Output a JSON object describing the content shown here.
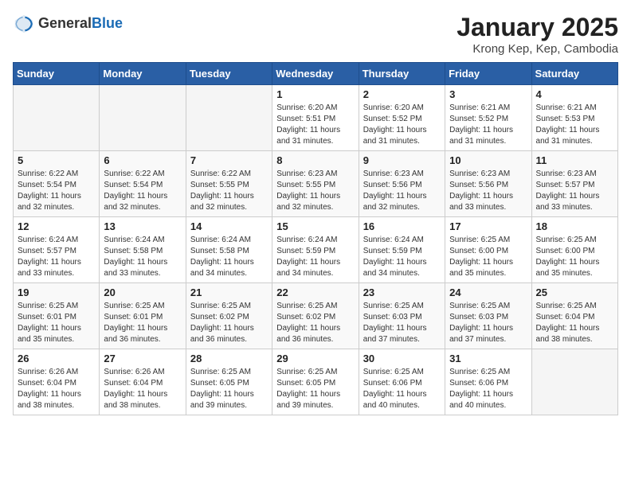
{
  "header": {
    "logo_general": "General",
    "logo_blue": "Blue",
    "month": "January 2025",
    "location": "Krong Kep, Kep, Cambodia"
  },
  "weekdays": [
    "Sunday",
    "Monday",
    "Tuesday",
    "Wednesday",
    "Thursday",
    "Friday",
    "Saturday"
  ],
  "weeks": [
    [
      {
        "day": "",
        "sunrise": "",
        "sunset": "",
        "daylight": ""
      },
      {
        "day": "",
        "sunrise": "",
        "sunset": "",
        "daylight": ""
      },
      {
        "day": "",
        "sunrise": "",
        "sunset": "",
        "daylight": ""
      },
      {
        "day": "1",
        "sunrise": "Sunrise: 6:20 AM",
        "sunset": "Sunset: 5:51 PM",
        "daylight": "Daylight: 11 hours and 31 minutes."
      },
      {
        "day": "2",
        "sunrise": "Sunrise: 6:20 AM",
        "sunset": "Sunset: 5:52 PM",
        "daylight": "Daylight: 11 hours and 31 minutes."
      },
      {
        "day": "3",
        "sunrise": "Sunrise: 6:21 AM",
        "sunset": "Sunset: 5:52 PM",
        "daylight": "Daylight: 11 hours and 31 minutes."
      },
      {
        "day": "4",
        "sunrise": "Sunrise: 6:21 AM",
        "sunset": "Sunset: 5:53 PM",
        "daylight": "Daylight: 11 hours and 31 minutes."
      }
    ],
    [
      {
        "day": "5",
        "sunrise": "Sunrise: 6:22 AM",
        "sunset": "Sunset: 5:54 PM",
        "daylight": "Daylight: 11 hours and 32 minutes."
      },
      {
        "day": "6",
        "sunrise": "Sunrise: 6:22 AM",
        "sunset": "Sunset: 5:54 PM",
        "daylight": "Daylight: 11 hours and 32 minutes."
      },
      {
        "day": "7",
        "sunrise": "Sunrise: 6:22 AM",
        "sunset": "Sunset: 5:55 PM",
        "daylight": "Daylight: 11 hours and 32 minutes."
      },
      {
        "day": "8",
        "sunrise": "Sunrise: 6:23 AM",
        "sunset": "Sunset: 5:55 PM",
        "daylight": "Daylight: 11 hours and 32 minutes."
      },
      {
        "day": "9",
        "sunrise": "Sunrise: 6:23 AM",
        "sunset": "Sunset: 5:56 PM",
        "daylight": "Daylight: 11 hours and 32 minutes."
      },
      {
        "day": "10",
        "sunrise": "Sunrise: 6:23 AM",
        "sunset": "Sunset: 5:56 PM",
        "daylight": "Daylight: 11 hours and 33 minutes."
      },
      {
        "day": "11",
        "sunrise": "Sunrise: 6:23 AM",
        "sunset": "Sunset: 5:57 PM",
        "daylight": "Daylight: 11 hours and 33 minutes."
      }
    ],
    [
      {
        "day": "12",
        "sunrise": "Sunrise: 6:24 AM",
        "sunset": "Sunset: 5:57 PM",
        "daylight": "Daylight: 11 hours and 33 minutes."
      },
      {
        "day": "13",
        "sunrise": "Sunrise: 6:24 AM",
        "sunset": "Sunset: 5:58 PM",
        "daylight": "Daylight: 11 hours and 33 minutes."
      },
      {
        "day": "14",
        "sunrise": "Sunrise: 6:24 AM",
        "sunset": "Sunset: 5:58 PM",
        "daylight": "Daylight: 11 hours and 34 minutes."
      },
      {
        "day": "15",
        "sunrise": "Sunrise: 6:24 AM",
        "sunset": "Sunset: 5:59 PM",
        "daylight": "Daylight: 11 hours and 34 minutes."
      },
      {
        "day": "16",
        "sunrise": "Sunrise: 6:24 AM",
        "sunset": "Sunset: 5:59 PM",
        "daylight": "Daylight: 11 hours and 34 minutes."
      },
      {
        "day": "17",
        "sunrise": "Sunrise: 6:25 AM",
        "sunset": "Sunset: 6:00 PM",
        "daylight": "Daylight: 11 hours and 35 minutes."
      },
      {
        "day": "18",
        "sunrise": "Sunrise: 6:25 AM",
        "sunset": "Sunset: 6:00 PM",
        "daylight": "Daylight: 11 hours and 35 minutes."
      }
    ],
    [
      {
        "day": "19",
        "sunrise": "Sunrise: 6:25 AM",
        "sunset": "Sunset: 6:01 PM",
        "daylight": "Daylight: 11 hours and 35 minutes."
      },
      {
        "day": "20",
        "sunrise": "Sunrise: 6:25 AM",
        "sunset": "Sunset: 6:01 PM",
        "daylight": "Daylight: 11 hours and 36 minutes."
      },
      {
        "day": "21",
        "sunrise": "Sunrise: 6:25 AM",
        "sunset": "Sunset: 6:02 PM",
        "daylight": "Daylight: 11 hours and 36 minutes."
      },
      {
        "day": "22",
        "sunrise": "Sunrise: 6:25 AM",
        "sunset": "Sunset: 6:02 PM",
        "daylight": "Daylight: 11 hours and 36 minutes."
      },
      {
        "day": "23",
        "sunrise": "Sunrise: 6:25 AM",
        "sunset": "Sunset: 6:03 PM",
        "daylight": "Daylight: 11 hours and 37 minutes."
      },
      {
        "day": "24",
        "sunrise": "Sunrise: 6:25 AM",
        "sunset": "Sunset: 6:03 PM",
        "daylight": "Daylight: 11 hours and 37 minutes."
      },
      {
        "day": "25",
        "sunrise": "Sunrise: 6:25 AM",
        "sunset": "Sunset: 6:04 PM",
        "daylight": "Daylight: 11 hours and 38 minutes."
      }
    ],
    [
      {
        "day": "26",
        "sunrise": "Sunrise: 6:26 AM",
        "sunset": "Sunset: 6:04 PM",
        "daylight": "Daylight: 11 hours and 38 minutes."
      },
      {
        "day": "27",
        "sunrise": "Sunrise: 6:26 AM",
        "sunset": "Sunset: 6:04 PM",
        "daylight": "Daylight: 11 hours and 38 minutes."
      },
      {
        "day": "28",
        "sunrise": "Sunrise: 6:25 AM",
        "sunset": "Sunset: 6:05 PM",
        "daylight": "Daylight: 11 hours and 39 minutes."
      },
      {
        "day": "29",
        "sunrise": "Sunrise: 6:25 AM",
        "sunset": "Sunset: 6:05 PM",
        "daylight": "Daylight: 11 hours and 39 minutes."
      },
      {
        "day": "30",
        "sunrise": "Sunrise: 6:25 AM",
        "sunset": "Sunset: 6:06 PM",
        "daylight": "Daylight: 11 hours and 40 minutes."
      },
      {
        "day": "31",
        "sunrise": "Sunrise: 6:25 AM",
        "sunset": "Sunset: 6:06 PM",
        "daylight": "Daylight: 11 hours and 40 minutes."
      },
      {
        "day": "",
        "sunrise": "",
        "sunset": "",
        "daylight": ""
      }
    ]
  ]
}
